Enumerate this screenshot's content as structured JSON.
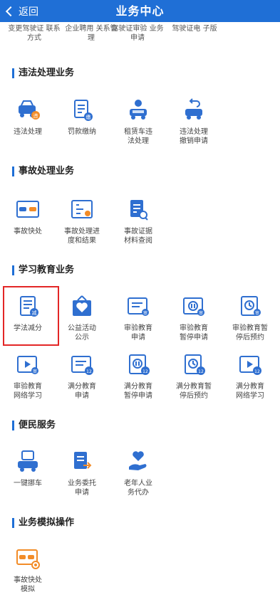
{
  "header": {
    "back_label": "返回",
    "title": "业务中心"
  },
  "top_partial": [
    "变更驾驶证\n联系方式",
    "企业聘用\n关系管理",
    "驾驶证审验\n业务申请",
    "驾驶证电\n子版"
  ],
  "sections": {
    "violation": {
      "title": "违法处理业务",
      "items": [
        "违法处理",
        "罚款缴纳",
        "租赁车违\n法处理",
        "违法处理\n撤销申请"
      ]
    },
    "accident": {
      "title": "事故处理业务",
      "items": [
        "事故快处",
        "事故处理进\n度和结果",
        "事故证据\n材料查阅"
      ]
    },
    "education": {
      "title": "学习教育业务",
      "items": [
        "学法减分",
        "公益活动\n公示",
        "审验教育\n申请",
        "审验教育\n暂停申请",
        "审验教育暂\n停后预约",
        "审验教育\n网络学习",
        "满分教育\n申请",
        "满分教育\n暂停申请",
        "满分教育暂\n停后预约",
        "满分教育\n网络学习"
      ]
    },
    "convenience": {
      "title": "便民服务",
      "items": [
        "一键挪车",
        "业务委托\n申请",
        "老年人业\n务代办"
      ]
    },
    "simulation": {
      "title": "业务模拟操作",
      "items": [
        "事故快处\n模拟"
      ]
    }
  },
  "icon_badges": {
    "violation": "违",
    "fine": "缴",
    "score": "减",
    "exam_short": "审",
    "full_score": "12"
  },
  "colors": {
    "brand": "#1f6fd6",
    "highlight": "#e32626",
    "icon_orange": "#f28c28"
  }
}
